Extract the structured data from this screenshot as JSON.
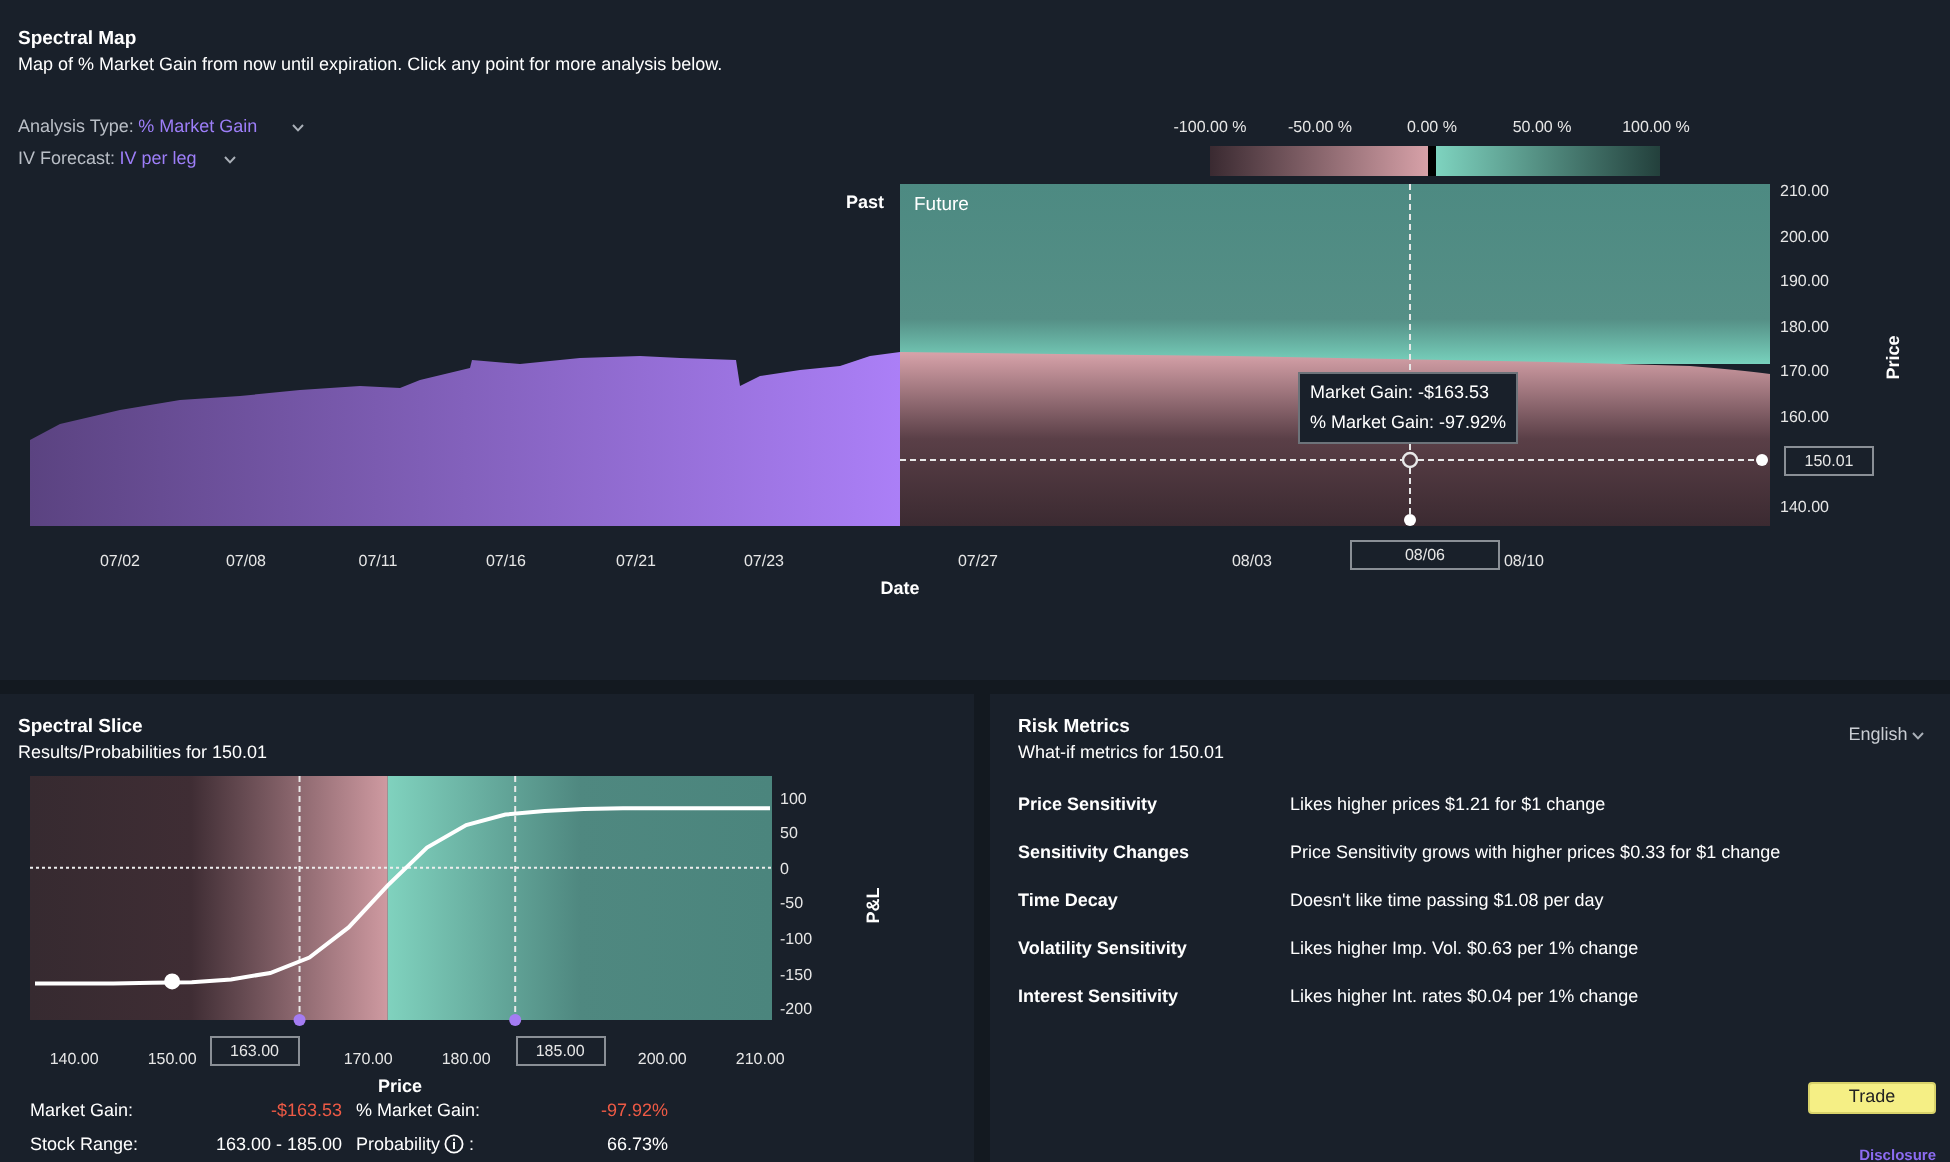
{
  "spectral_map": {
    "title": "Spectral Map",
    "subtitle": "Map of % Market Gain from now until expiration. Click any point for more analysis below.",
    "controls": [
      {
        "label": "Analysis Type:",
        "value": "% Market Gain"
      },
      {
        "label": "IV Forecast:",
        "value": "IV per leg"
      }
    ],
    "legend": [
      "-100.00 %",
      "-50.00 %",
      "0.00 %",
      "50.00 %",
      "100.00 %"
    ],
    "chart": {
      "past_label": "Past",
      "future_label": "Future",
      "price_ticks": [
        "210.00",
        "200.00",
        "190.00",
        "180.00",
        "170.00",
        "160.00",
        "140.00"
      ],
      "date_ticks": [
        "07/02",
        "07/08",
        "07/11",
        "07/16",
        "07/21",
        "07/23",
        "07/27",
        "08/03",
        "08/10"
      ],
      "xlabel": "Date",
      "ylabel": "Price",
      "tooltip": [
        "Market Gain: -$163.53",
        "% Market Gain: -97.92%"
      ],
      "selected_price": "150.01",
      "selected_date": "08/06"
    }
  },
  "spectral_slice": {
    "title": "Spectral Slice",
    "subtitle": "Results/Probabilities for 150.01",
    "chart_data": {
      "type": "line",
      "xlabel": "Price",
      "ylabel": "P&L",
      "xlim": [
        135.5,
        211.2
      ],
      "ylim": [
        -217,
        131
      ],
      "xticks": [
        {
          "value": 140,
          "label": "140.00"
        },
        {
          "value": 150,
          "label": "150.00"
        },
        {
          "value": 170,
          "label": "170.00"
        },
        {
          "value": 180,
          "label": "180.00"
        },
        {
          "value": 200,
          "label": "200.00"
        },
        {
          "value": 210,
          "label": "210.00"
        }
      ],
      "yticks": [
        100,
        50,
        0,
        -50,
        -100,
        -150,
        -200
      ],
      "x": [
        136,
        140,
        144,
        148,
        152,
        156,
        160,
        164,
        168,
        172,
        176,
        180,
        184,
        188,
        192,
        196,
        200,
        204,
        208,
        211
      ],
      "series": [
        {
          "color": "#ffffff",
          "values": [
            -165,
            -165,
            -165,
            -164,
            -163,
            -159,
            -150,
            -128,
            -85,
            -25,
            29,
            61,
            76,
            81,
            84,
            85,
            85,
            85,
            85,
            85
          ]
        }
      ],
      "ref_lines": [
        {
          "axis": "x",
          "value": 163,
          "label": "163.00"
        },
        {
          "axis": "x",
          "value": 185,
          "label": "185.00"
        }
      ]
    },
    "stats": [
      {
        "label": "Market Gain:",
        "value": "-$163.53",
        "color": "#ee5a45"
      },
      {
        "label": "% Market Gain:",
        "value": "-97.92%",
        "color": "#ee5a45"
      },
      {
        "label": "Stock Range:",
        "value": "163.00 - 185.00",
        "color": "#ffffff"
      },
      {
        "label": "Probability",
        "info": true,
        "after_icon": ":",
        "value": "66.73%",
        "color": "#ffffff"
      }
    ]
  },
  "risk_metrics": {
    "title": "Risk Metrics",
    "subtitle": "What-if metrics for 150.01",
    "language": "English",
    "rows": [
      {
        "label": "Price Sensitivity",
        "value": "Likes higher prices $1.21 for $1 change"
      },
      {
        "label": "Sensitivity Changes",
        "value": "Price Sensitivity grows with higher prices $0.33 for $1 change"
      },
      {
        "label": "Time Decay",
        "value": "Doesn't like time passing $1.08 per day"
      },
      {
        "label": "Volatility Sensitivity",
        "value": "Likes higher Imp. Vol. $0.63 per 1% change"
      },
      {
        "label": "Interest Sensitivity",
        "value": "Likes higher Int. rates $0.04 per 1% change"
      }
    ],
    "trade_button": "Trade",
    "disclosure": "Disclosure"
  }
}
